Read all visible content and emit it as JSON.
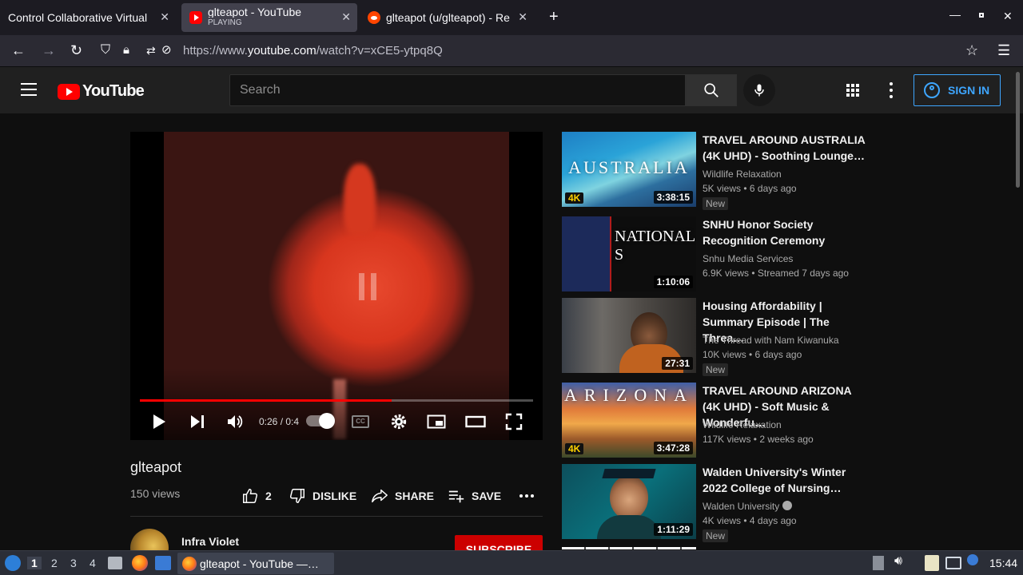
{
  "browser": {
    "tabs": [
      {
        "label": "Control Collaborative Virtual",
        "sublabel": ""
      },
      {
        "label": "glteapot - YouTube",
        "sublabel": "PLAYING"
      },
      {
        "label": "glteapot (u/glteapot) - Re",
        "sublabel": ""
      }
    ],
    "url_prefix": "https://www.",
    "url_domain": "youtube.com",
    "url_path": "/watch?v=xCE5-ytpq8Q"
  },
  "youtube": {
    "logo_text": "YouTube",
    "search_placeholder": "Search",
    "signin_label": "SIGN IN"
  },
  "player": {
    "time": "0:26 / 0:4",
    "progress": 0.64
  },
  "video": {
    "title": "glteapot",
    "views": "150 views",
    "likes": "2",
    "dislike_label": "DISLIKE",
    "share_label": "SHARE",
    "save_label": "SAVE"
  },
  "channel": {
    "name": "Infra Violet",
    "subscribe_label": "SUBSCRIBE"
  },
  "recommendations": [
    {
      "title": "TRAVEL AROUND AUSTRALIA (4K UHD) - Soothing Lounge…",
      "channel": "Wildlife Relaxation",
      "meta": "5K views • 6 days ago",
      "duration": "3:38:15",
      "badge": "New",
      "quality": "4K",
      "thumb_text": "AUSTRALIA",
      "verified": false
    },
    {
      "title": "SNHU Honor Society Recognition Ceremony",
      "channel": "Snhu Media Services",
      "meta": "6.9K views • Streamed 7 days ago",
      "duration": "1:10:06",
      "badge": "",
      "quality": "",
      "thumb_text": "NATIONAL S",
      "verified": false
    },
    {
      "title": "Housing Affordability | Summary Episode | The Threa…",
      "channel": "The Thread with Nam Kiwanuka",
      "meta": "10K views • 6 days ago",
      "duration": "27:31",
      "badge": "New",
      "quality": "",
      "thumb_text": "",
      "verified": false
    },
    {
      "title": "TRAVEL AROUND ARIZONA (4K UHD) - Soft Music & Wonderfu…",
      "channel": "Wildlife Relaxation",
      "meta": "117K views • 2 weeks ago",
      "duration": "3:47:28",
      "badge": "",
      "quality": "4K",
      "thumb_text": "ARIZONA",
      "verified": false
    },
    {
      "title": "Walden University's Winter 2022 College of Nursing…",
      "channel": "Walden University",
      "meta": "4K views • 4 days ago",
      "duration": "1:11:29",
      "badge": "New",
      "quality": "",
      "thumb_text": "",
      "verified": true
    }
  ],
  "taskbar": {
    "workspaces": [
      "1",
      "2",
      "3",
      "4"
    ],
    "window_label": "glteapot - YouTube —…",
    "clock": "15:44"
  },
  "colors": {
    "youtube_red": "#ff0000",
    "progress_red": "#ff0000",
    "link_blue": "#3ea6ff",
    "background": "#0f0f0f"
  }
}
